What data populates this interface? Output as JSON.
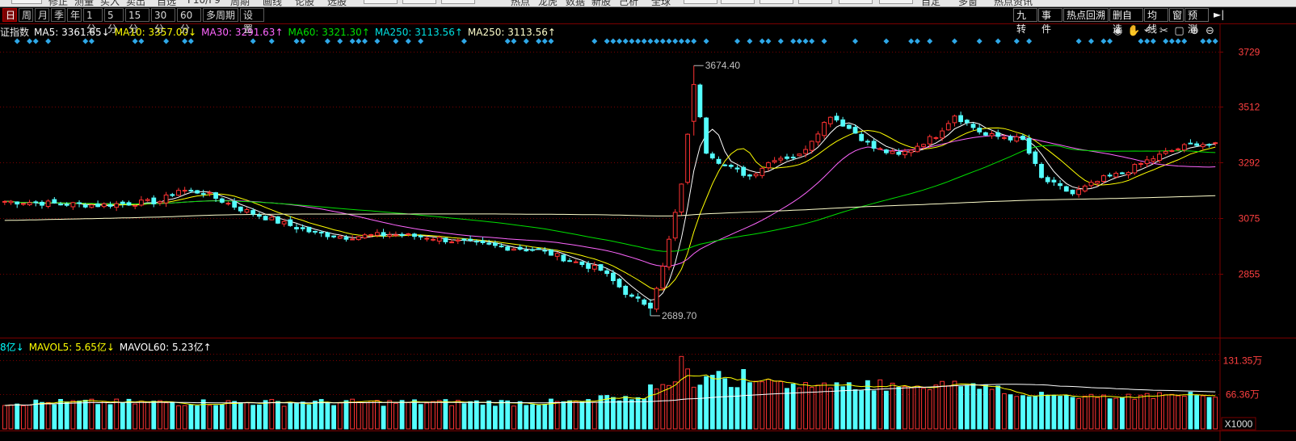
{
  "toolbar": {
    "top_fragments": [
      "修正",
      "测量",
      "买入",
      "卖出",
      "自选",
      "F10/F9",
      "周期",
      "画线",
      "论股",
      "选股",
      "热点",
      "龙虎",
      "数据",
      "新股",
      "己析",
      "全球",
      "自定",
      "多窗",
      "热点资讯"
    ],
    "periods": [
      "日",
      "周",
      "月",
      "季",
      "年",
      "1分",
      "5分",
      "15分",
      "30分",
      "60分",
      "多周期",
      "设置"
    ],
    "active_period": "日",
    "tools": [
      "九转",
      "事件",
      "热点回溯",
      "删自选",
      "均线",
      "窗",
      "预测"
    ],
    "expand_icon": "►|"
  },
  "ma_legend": {
    "name": "证指数",
    "items": [
      {
        "label": "MA5: 3361.65↓",
        "color": "#ffffff"
      },
      {
        "label": "MA10: 3357.00↓",
        "color": "#ffff00"
      },
      {
        "label": "MA30: 3291.63↑",
        "color": "#ff66ff"
      },
      {
        "label": "MA60: 3321.30↑",
        "color": "#00e000"
      },
      {
        "label": "MA250: 3113.56↑",
        "color": "#00e0e0"
      },
      {
        "label": "MA250: 3113.56↑",
        "color": "#ffffcc"
      }
    ]
  },
  "vol_legend": {
    "items": [
      {
        "label": "8亿↓",
        "color": "#00ffff"
      },
      {
        "label": "MAVOL5: 5.65亿↓",
        "color": "#ffff00"
      },
      {
        "label": "MAVOL60: 5.23亿↑",
        "color": "#ffffff"
      }
    ]
  },
  "chart_controls": [
    "eye-icon",
    "hand-icon",
    "undo-icon",
    "scissors-icon",
    "lock-icon",
    "zoom-in-icon",
    "zoom-out-icon"
  ],
  "colors": {
    "up": "#ff3232",
    "down": "#54ffff",
    "grid": "#7a0000",
    "axis_text": "#ff4040",
    "annotation": "#c0c0c0",
    "signal_diamond": "#2ea8e8"
  },
  "chart_data": {
    "type": "candlestick",
    "y_ticks": [
      2855,
      3075,
      3292,
      3512,
      3729
    ],
    "y_tick_labels": [
      "2855",
      "3075",
      "3292",
      "3512",
      "3729"
    ],
    "ylim": [
      2610,
      3780
    ],
    "annotations": [
      {
        "label": "3674.40",
        "value": 3674.4
      },
      {
        "label": "2689.70",
        "value": 2689.7
      }
    ],
    "volume": {
      "y_ticks": [
        663600,
        1313500
      ],
      "y_tick_labels": [
        "66.36万",
        "131.35万"
      ],
      "unit_label": "X1000",
      "ylim": [
        0,
        1400000
      ]
    },
    "anchors": [
      [
        0,
        3140
      ],
      [
        15,
        3125
      ],
      [
        25,
        3140
      ],
      [
        28,
        3185
      ],
      [
        32,
        3175
      ],
      [
        38,
        3110
      ],
      [
        44,
        3060
      ],
      [
        50,
        3015
      ],
      [
        55,
        3000
      ],
      [
        62,
        3010
      ],
      [
        68,
        3000
      ],
      [
        72,
        2985
      ],
      [
        80,
        2960
      ],
      [
        86,
        2950
      ],
      [
        92,
        2900
      ],
      [
        96,
        2870
      ],
      [
        101,
        2760
      ],
      [
        104,
        2730
      ],
      [
        106,
        2880
      ],
      [
        109,
        3200
      ],
      [
        111,
        3620
      ],
      [
        113,
        3340
      ],
      [
        116,
        3280
      ],
      [
        120,
        3240
      ],
      [
        124,
        3310
      ],
      [
        128,
        3320
      ],
      [
        133,
        3480
      ],
      [
        137,
        3410
      ],
      [
        140,
        3350
      ],
      [
        144,
        3320
      ],
      [
        150,
        3400
      ],
      [
        153,
        3480
      ],
      [
        158,
        3400
      ],
      [
        162,
        3390
      ],
      [
        164,
        3380
      ],
      [
        167,
        3230
      ],
      [
        172,
        3170
      ],
      [
        177,
        3230
      ],
      [
        180,
        3250
      ],
      [
        184,
        3300
      ],
      [
        188,
        3340
      ],
      [
        192,
        3370
      ],
      [
        195,
        3360
      ]
    ],
    "bar_count": 196,
    "ma_periods": [
      5,
      10,
      30,
      60,
      250
    ],
    "ma_colors": [
      "#ffffff",
      "#ffff00",
      "#ff66ff",
      "#00e000",
      "#ffffcc"
    ]
  }
}
